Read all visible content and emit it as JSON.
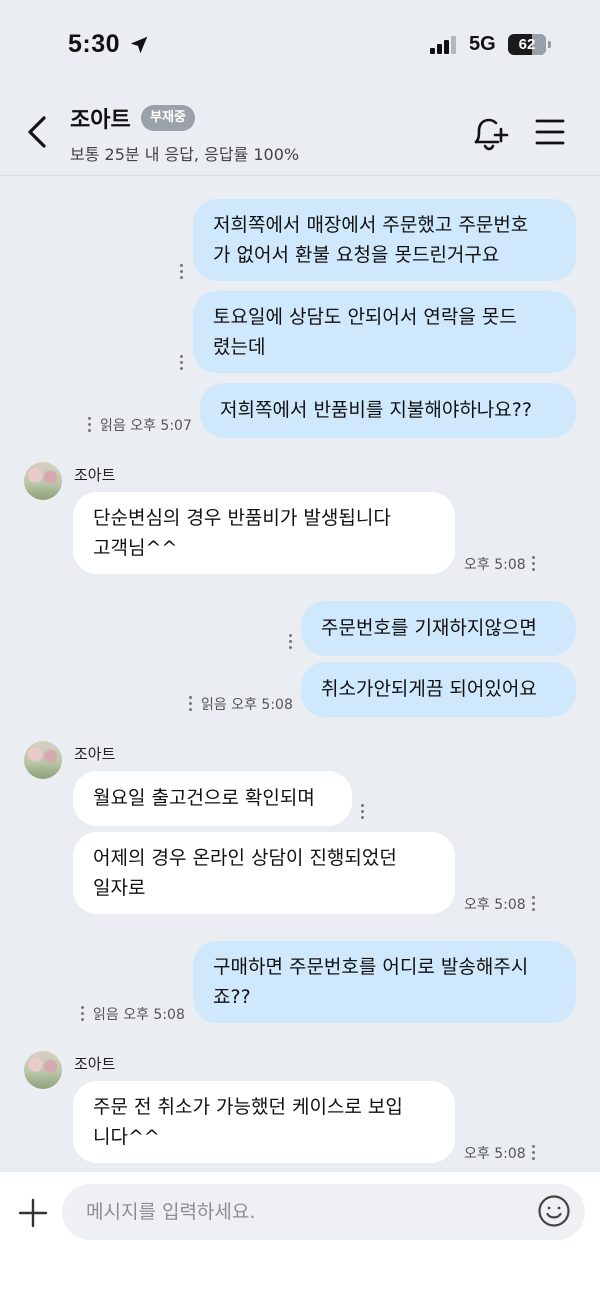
{
  "status_bar": {
    "time": "5:30",
    "network": "5G",
    "battery": "62",
    "battery_level_percent": 62,
    "location_icon": "location-arrow-icon",
    "signal_icon": "cellular-signal-icon"
  },
  "header": {
    "name": "조아트",
    "badge": "부재중",
    "response_info": "보통 25분 내 응답, 응답률 100%",
    "back_icon": "chevron-left-icon",
    "bell_icon": "bell-plus-icon",
    "menu_icon": "hamburger-menu-icon"
  },
  "messages": [
    {
      "side": "out",
      "text_lines": [
        "저희쪽에서 매장에서 주문했고 주문번호",
        "가 없어서 환불 요청을 못드린거구요"
      ]
    },
    {
      "side": "out",
      "text_lines": [
        "토요일에 상담도 안되어서 연락을 못드",
        "렸는데"
      ]
    },
    {
      "side": "out",
      "text_lines": [
        "저희쪽에서 반품비를 지불해야하나요??"
      ],
      "meta": "읽음 오후 5:07"
    },
    {
      "side": "in",
      "sender": "조아트",
      "text_lines": [
        "단순변심의 경우 반품비가 발생됩니다",
        "고객님^^"
      ],
      "meta": "오후 5:08"
    },
    {
      "side": "out",
      "text_lines": [
        "주문번호를 기재하지않으면"
      ]
    },
    {
      "side": "out",
      "text_lines": [
        "취소가안되게끔 되어있어요"
      ],
      "meta": "읽음 오후 5:08"
    },
    {
      "side": "in",
      "sender": "조아트",
      "text_lines": [
        "월요일 출고건으로 확인되며"
      ]
    },
    {
      "side": "in",
      "text_lines": [
        "어제의 경우 온라인 상담이 진행되었던",
        "일자로"
      ],
      "meta": "오후 5:08"
    },
    {
      "side": "out",
      "text_lines": [
        "구매하면 주문번호를 어디로 발송해주시",
        "죠??"
      ],
      "meta": "읽음 오후 5:08"
    },
    {
      "side": "in",
      "sender": "조아트",
      "text_lines": [
        "주문 전 취소가 가능했던 케이스로 보입",
        "니다^^"
      ],
      "meta": "오후 5:08"
    }
  ],
  "input": {
    "placeholder": "메시지를 입력하세요.",
    "plus_icon": "plus-icon",
    "emoji_icon": "smiley-emoji-icon"
  },
  "colors": {
    "background": "#eaeef3",
    "outgoing_bubble": "#cfe8fb",
    "incoming_bubble": "#ffffff",
    "badge": "#9aa1ab"
  }
}
